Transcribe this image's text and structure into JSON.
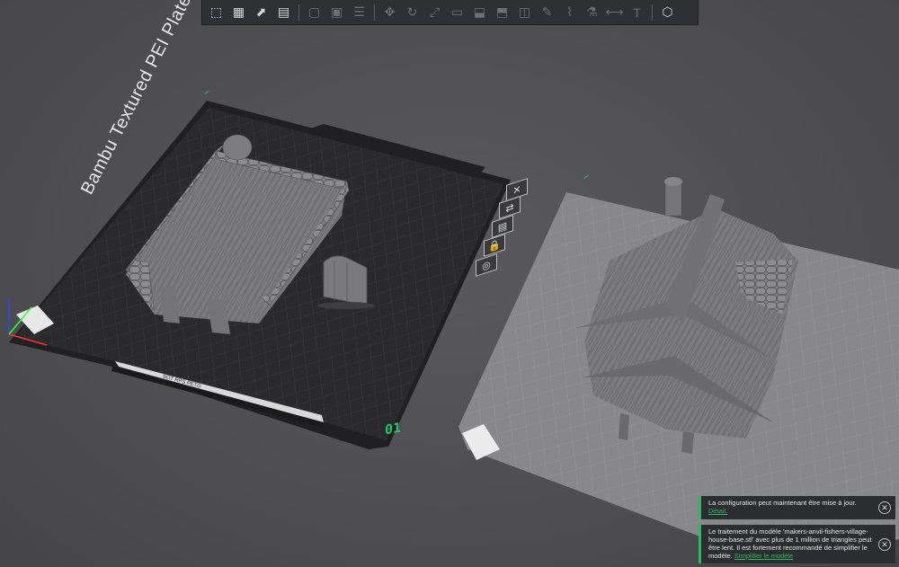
{
  "toolbar": {
    "items": [
      {
        "icon": "add-cube-icon",
        "glyph": "⬚",
        "enabled": true
      },
      {
        "icon": "grid-arrange-icon",
        "glyph": "▦",
        "enabled": true
      },
      {
        "icon": "orient-icon",
        "glyph": "⬈",
        "enabled": true
      },
      {
        "icon": "plate-layout-icon",
        "glyph": "▤",
        "enabled": true
      },
      {
        "icon": "copy-icon",
        "glyph": "▢",
        "enabled": false
      },
      {
        "icon": "paste-icon",
        "glyph": "▣",
        "enabled": false
      },
      {
        "icon": "list-icon",
        "glyph": "☰",
        "enabled": false
      },
      {
        "icon": "move-icon",
        "glyph": "✥",
        "enabled": false
      },
      {
        "icon": "rotate-icon",
        "glyph": "↻",
        "enabled": false
      },
      {
        "icon": "scale-icon",
        "glyph": "⤢",
        "enabled": false
      },
      {
        "icon": "lay-on-face-icon",
        "glyph": "▭",
        "enabled": false
      },
      {
        "icon": "cut-icon",
        "glyph": "⬓",
        "enabled": false
      },
      {
        "icon": "split-icon",
        "glyph": "⬒",
        "enabled": false
      },
      {
        "icon": "boolean-icon",
        "glyph": "◫",
        "enabled": false
      },
      {
        "icon": "support-paint-icon",
        "glyph": "✎",
        "enabled": false
      },
      {
        "icon": "seam-paint-icon",
        "glyph": "⌇",
        "enabled": false
      },
      {
        "icon": "color-paint-icon",
        "glyph": "⚗",
        "enabled": false
      },
      {
        "icon": "measure-icon",
        "glyph": "⟷",
        "enabled": false
      },
      {
        "icon": "text-icon",
        "glyph": "T",
        "enabled": false
      },
      {
        "icon": "assembly-icon",
        "glyph": "⬡",
        "enabled": true
      }
    ]
  },
  "plates": {
    "left": {
      "label": "Bambu Textured PEI Plate",
      "number": "01",
      "bed_sticker": "SOT RPS PETG"
    },
    "right": {
      "number": ""
    }
  },
  "plate_icons": [
    {
      "icon": "close-plate-icon",
      "glyph": "✕"
    },
    {
      "icon": "auto-arrange-icon",
      "glyph": "⇄"
    },
    {
      "icon": "plate-settings-icon",
      "glyph": "▤"
    },
    {
      "icon": "lock-plate-icon",
      "glyph": "🔒"
    },
    {
      "icon": "orient-plate-icon",
      "glyph": "◎"
    }
  ],
  "notifications": [
    {
      "text": "La configuration peut maintenant être mise à jour.",
      "link": "Détail."
    },
    {
      "text": "Le traitement du modèle 'makers-anvil-fishers-village-house-base.stl' avec plus de 1 million de triangles peut être lent. Il est fortement recommandé de simplifier le modèle.",
      "link": "Simplifier le modèle"
    }
  ],
  "colors": {
    "accent": "#2eb860",
    "background": "#4e4e50",
    "toolbar": "#2f3033",
    "plate_textured": "#2b2b2d",
    "plate_light": "#8a8a8c"
  }
}
